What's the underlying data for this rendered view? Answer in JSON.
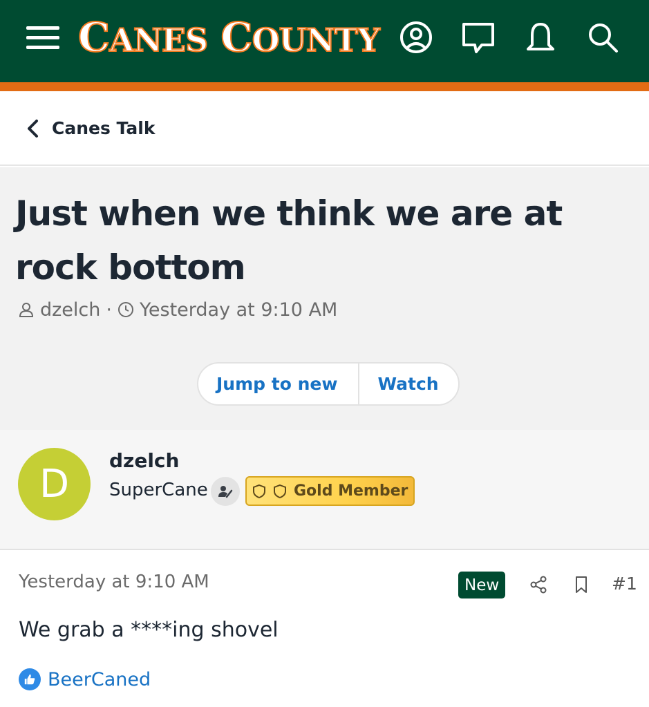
{
  "header": {
    "logo_cap1": "C",
    "logo_rest1": "ANES",
    "logo_cap2": "C",
    "logo_rest2": "OUNTY",
    "brand_green": "#004b31",
    "brand_orange": "#e26c14",
    "icons": [
      "menu-icon",
      "account-icon",
      "conversations-icon",
      "alerts-icon",
      "search-icon"
    ]
  },
  "breadcrumb": {
    "label": "Canes Talk"
  },
  "thread": {
    "title": "Just when we think we are at rock bottom",
    "author": "dzelch",
    "separator": "·",
    "date": "Yesterday at 9:10 AM",
    "buttons": {
      "jump": "Jump to new",
      "watch": "Watch"
    }
  },
  "poster": {
    "avatar_letter": "D",
    "avatar_color": "#c5cf35",
    "username": "dzelch",
    "user_title": "SuperCane",
    "badge_label": "Gold Member"
  },
  "post": {
    "time": "Yesterday at 9:10 AM",
    "new_label": "New",
    "number": "#1",
    "body": "We grab a ****ing shovel",
    "reaction_user": "BeerCaned"
  }
}
